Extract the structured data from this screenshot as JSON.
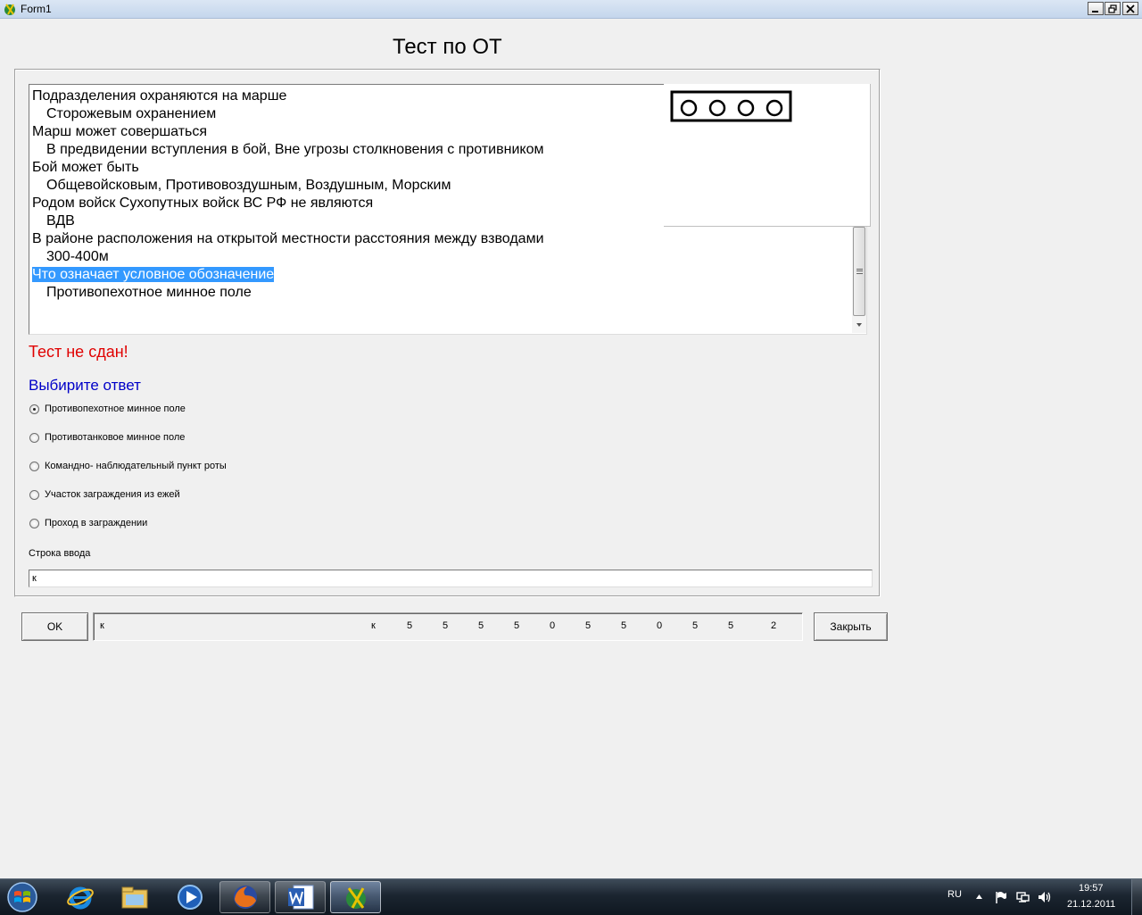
{
  "window": {
    "title": "Form1"
  },
  "form": {
    "heading": "Тест по ОТ"
  },
  "memo": {
    "lines": [
      {
        "text": "Подразделения охраняются на марше",
        "kind": "question"
      },
      {
        "text": "Сторожевым охранением",
        "kind": "answer"
      },
      {
        "text": "Марш может совершаться",
        "kind": "question"
      },
      {
        "text": "В предвидении вступления в бой, Вне угрозы столкновения с противником",
        "kind": "answer"
      },
      {
        "text": "Бой может быть",
        "kind": "question"
      },
      {
        "text": "Общевойсковым, Противовоздушным, Воздушным, Морским",
        "kind": "answer"
      },
      {
        "text": "Родом войск Сухопутных войск ВС РФ не являются",
        "kind": "question"
      },
      {
        "text": "ВДВ",
        "kind": "answer"
      },
      {
        "text": "В районе расположения на открытой местности расстояния между взводами",
        "kind": "question"
      },
      {
        "text": "300-400м",
        "kind": "answer"
      },
      {
        "text": "Что означает условное обозначение",
        "kind": "question",
        "selected": true
      },
      {
        "text": "Противопехотное минное поле",
        "kind": "answer"
      }
    ]
  },
  "result": {
    "text": "Тест не сдан!",
    "color": "#e00000"
  },
  "prompt": {
    "text": "Выбирите ответ",
    "color": "#0000c8"
  },
  "options": [
    {
      "label": "Противопехотное минное поле",
      "checked": true
    },
    {
      "label": "Противотанковое минное поле",
      "checked": false
    },
    {
      "label": "Командно- наблюдательный пункт роты",
      "checked": false
    },
    {
      "label": "Участок заграждения  из ежей",
      "checked": false
    },
    {
      "label": "Проход в заграждении",
      "checked": false
    }
  ],
  "input": {
    "label": "Строка ввода",
    "value": "к"
  },
  "buttons": {
    "ok": "OK",
    "close": "Закрыть"
  },
  "status_values": [
    "к",
    "к",
    "5",
    "5",
    "5",
    "5",
    "0",
    "5",
    "5",
    "0",
    "5",
    "5",
    "2"
  ],
  "taskbar": {
    "language": "RU",
    "time": "19:57",
    "date": "21.12.2011"
  }
}
